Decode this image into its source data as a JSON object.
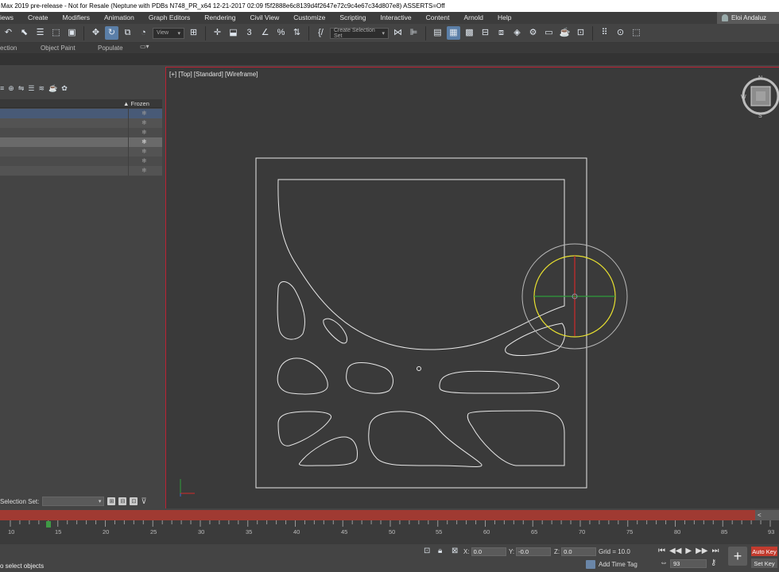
{
  "window": {
    "title": "Max 2019 pre-release - Not for Resale (Neptune with PDBs N748_PR_x64 12-21-2017 02:09 f5f2888e6c8139d4f2647e72c9c4e67c34d807e8) ASSERTS=Off"
  },
  "menu": {
    "items": [
      "iews",
      "Create",
      "Modifiers",
      "Animation",
      "Graph Editors",
      "Rendering",
      "Civil View",
      "Customize",
      "Scripting",
      "Interactive",
      "Content",
      "Arnold",
      "Help"
    ],
    "user": "Eloi Andaluz"
  },
  "toolbar": {
    "view_dropdown": "View",
    "selection_set_placeholder": "Create Selection Set"
  },
  "ribbon": {
    "tabs": [
      "ection",
      "Object Paint",
      "Populate"
    ]
  },
  "scene_explorer": {
    "column_header": "Frozen",
    "rows": [
      "blue",
      "normal",
      "dark",
      "light",
      "normal",
      "dark",
      "normal"
    ],
    "selection_set_label": "Selection Set:"
  },
  "viewport": {
    "label": "[+] [Top] [Standard] [Wireframe]",
    "accent_color": "#b22a2a",
    "gizmo_color": "#e8e030"
  },
  "timeline": {
    "tick_labels": [
      "10",
      "15",
      "20",
      "25",
      "30",
      "35",
      "40",
      "45",
      "50",
      "55",
      "60",
      "65",
      "70",
      "75",
      "80",
      "85",
      "93"
    ],
    "current_frame": "93"
  },
  "status": {
    "message": "o select objects",
    "x_label": "X:",
    "x_value": "0.0",
    "y_label": "Y:",
    "y_value": "-0.0",
    "z_label": "Z:",
    "z_value": "0.0",
    "grid": "Grid = 10.0",
    "add_time_tag": "Add Time Tag",
    "auto_key": "Auto Key",
    "set_key": "Set Key"
  }
}
